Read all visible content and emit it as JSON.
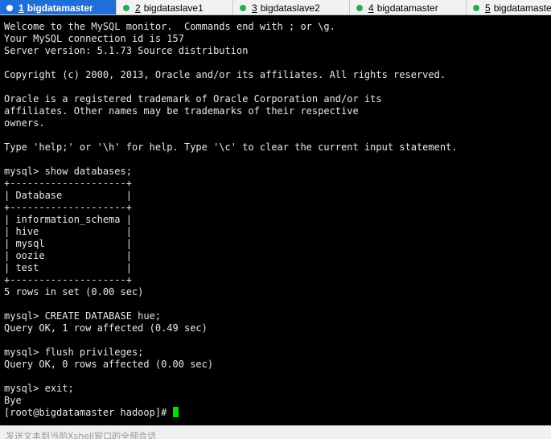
{
  "tabs": [
    {
      "num": "1",
      "label": "bigdatamaster",
      "active": true,
      "dot_color": "#ffffff"
    },
    {
      "num": "2",
      "label": "bigdataslave1",
      "active": false,
      "dot_color": "#22b14c"
    },
    {
      "num": "3",
      "label": "bigdataslave2",
      "active": false,
      "dot_color": "#22b14c"
    },
    {
      "num": "4",
      "label": "bigdatamaster",
      "active": false,
      "dot_color": "#22b14c"
    },
    {
      "num": "5",
      "label": "bigdatamaster",
      "active": false,
      "dot_color": "#22b14c"
    }
  ],
  "terminal": {
    "lines": [
      "Welcome to the MySQL monitor.  Commands end with ; or \\g.",
      "Your MySQL connection id is 157",
      "Server version: 5.1.73 Source distribution",
      "",
      "Copyright (c) 2000, 2013, Oracle and/or its affiliates. All rights reserved.",
      "",
      "Oracle is a registered trademark of Oracle Corporation and/or its",
      "affiliates. Other names may be trademarks of their respective",
      "owners.",
      "",
      "Type 'help;' or '\\h' for help. Type '\\c' to clear the current input statement.",
      "",
      "mysql> show databases;",
      "+--------------------+",
      "| Database           |",
      "+--------------------+",
      "| information_schema |",
      "| hive               |",
      "| mysql              |",
      "| oozie              |",
      "| test               |",
      "+--------------------+",
      "5 rows in set (0.00 sec)",
      "",
      "mysql> CREATE DATABASE hue;",
      "Query OK, 1 row affected (0.49 sec)",
      "",
      "mysql> flush privileges;",
      "Query OK, 0 rows affected (0.00 sec)",
      "",
      "mysql> exit;",
      "Bye"
    ],
    "prompt": "[root@bigdatamaster hadoop]# ",
    "cursor_color": "#00e000"
  },
  "composebar": {
    "placeholder": "发送文本到当前Xshell窗口的全部会话"
  },
  "colors": {
    "active_tab": "#1e6fd9",
    "terminal_bg": "#000000",
    "terminal_fg": "#e8e8e8"
  }
}
